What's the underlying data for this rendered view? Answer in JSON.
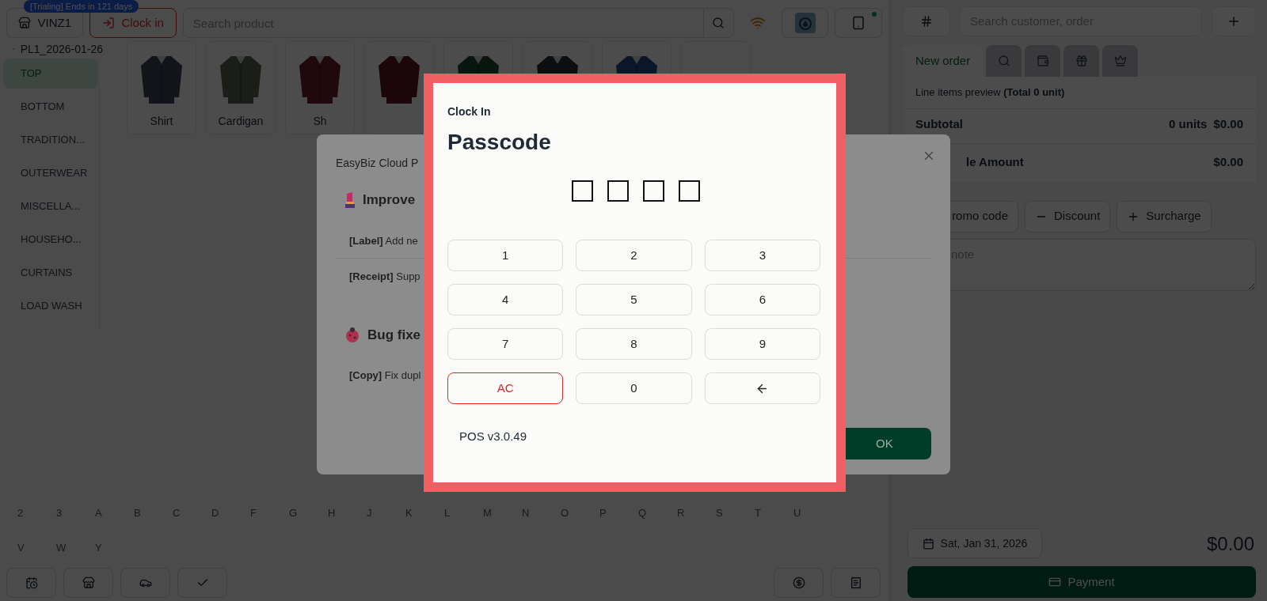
{
  "top_bar": {
    "trial_badge": "[Trialing] Ends in 121 days",
    "store_button": "VINZ1",
    "clock_in_button": "Clock in",
    "search": {
      "placeholder": "Search product"
    },
    "device_online": true
  },
  "price_list": "PL1_2026-01-26",
  "categories": [
    {
      "label": "TOP",
      "selected": true
    },
    {
      "label": "BOTTOM",
      "selected": false
    },
    {
      "label": "TRADITION...",
      "selected": false
    },
    {
      "label": "OUTERWEAR",
      "selected": false
    },
    {
      "label": "MISCELLA...",
      "selected": false
    },
    {
      "label": "HOUSEHO...",
      "selected": false
    },
    {
      "label": "CURTAINS",
      "selected": false
    },
    {
      "label": "LOAD WASH",
      "selected": false
    }
  ],
  "products": [
    {
      "kind": "picture",
      "name": "Shirt"
    },
    {
      "kind": "picture",
      "name": "Cardigan"
    },
    {
      "kind": "picture",
      "name": "Sh"
    },
    {
      "kind": "picture"
    },
    {
      "kind": "picture"
    },
    {
      "kind": "picture"
    },
    {
      "kind": "picture"
    },
    {
      "kind": "blank"
    }
  ],
  "alphabet": [
    "2",
    "3",
    "A",
    "B",
    "C",
    "D",
    "F",
    "G",
    "H",
    "J",
    "K",
    "L",
    "M",
    "N",
    "O",
    "P",
    "Q",
    "R",
    "S",
    "T",
    "U",
    "V",
    "W",
    "Y"
  ],
  "right_panel": {
    "search": {
      "placeholder": "Search customer, order"
    },
    "tabs": [
      {
        "kind": "text",
        "label": "New order",
        "selected": true
      },
      {
        "kind": "search",
        "selected": false
      },
      {
        "kind": "wallet",
        "selected": false
      },
      {
        "kind": "gift",
        "selected": false
      },
      {
        "kind": "crown",
        "selected": false
      }
    ],
    "preview": "Line items preview **(Total 0 unit)**",
    "subtotal": {
      "label": "Subtotal",
      "units": "0 units",
      "amount": "$0.00"
    },
    "sale_amount": {
      "label": "le Amount",
      "amount": "$0.00"
    },
    "adjust_buttons": [
      {
        "kind": "plain",
        "label": "romo code"
      },
      {
        "kind": "minus",
        "label": "Discount"
      },
      {
        "kind": "plus",
        "label": "Surcharge"
      }
    ],
    "note": {
      "placeholder": "note"
    },
    "date": "Sat, Jan 31, 2026",
    "total": "$0.00",
    "payment_button": "Payment"
  },
  "release_dialog": {
    "title": "EasyBiz Cloud P",
    "sections": [
      {
        "kind": "improvement",
        "heading": "Improve",
        "items": [
          "**[Label]** Add ne",
          "**[Receipt]** Supp"
        ]
      },
      {
        "kind": "bug",
        "heading": "Bug fixe",
        "items": [
          "**[Copy]** Fix dupl"
        ]
      }
    ],
    "ok_button": "OK"
  },
  "passcode_dialog": {
    "caption": "Clock In",
    "title": "Passcode",
    "digits": [
      {
        "filled": false
      },
      {
        "filled": false
      },
      {
        "filled": false
      },
      {
        "filled": false
      }
    ],
    "keys": [
      {
        "kind": "digit",
        "label": "1"
      },
      {
        "kind": "digit",
        "label": "2"
      },
      {
        "kind": "digit",
        "label": "3"
      },
      {
        "kind": "digit",
        "label": "4"
      },
      {
        "kind": "digit",
        "label": "5"
      },
      {
        "kind": "digit",
        "label": "6"
      },
      {
        "kind": "digit",
        "label": "7"
      },
      {
        "kind": "digit",
        "label": "8"
      },
      {
        "kind": "digit",
        "label": "9"
      },
      {
        "kind": "clear",
        "label": "AC"
      },
      {
        "kind": "digit",
        "label": "0"
      },
      {
        "kind": "backspace"
      }
    ],
    "version": "POS v3.0.49"
  }
}
